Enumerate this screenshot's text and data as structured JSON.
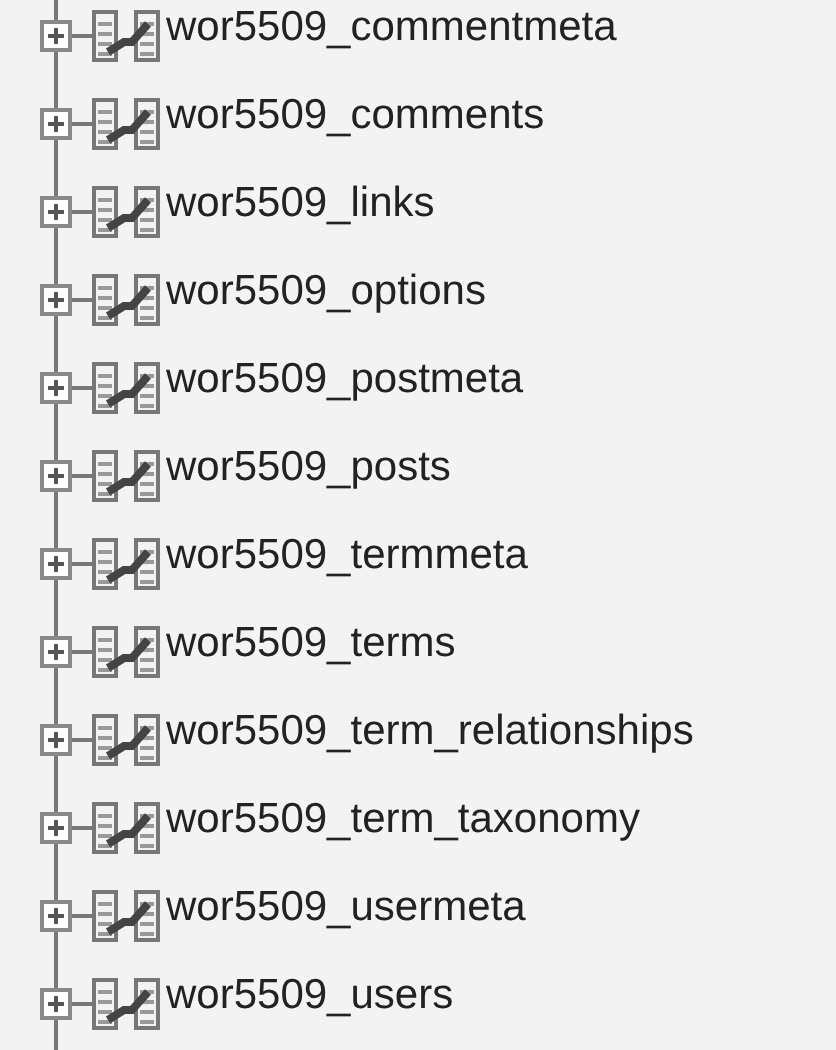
{
  "tables": [
    {
      "name": "wor5509_commentmeta",
      "expanded": false
    },
    {
      "name": "wor5509_comments",
      "expanded": false
    },
    {
      "name": "wor5509_links",
      "expanded": false
    },
    {
      "name": "wor5509_options",
      "expanded": false
    },
    {
      "name": "wor5509_postmeta",
      "expanded": false
    },
    {
      "name": "wor5509_posts",
      "expanded": false
    },
    {
      "name": "wor5509_termmeta",
      "expanded": false
    },
    {
      "name": "wor5509_terms",
      "expanded": false
    },
    {
      "name": "wor5509_term_relationships",
      "expanded": false
    },
    {
      "name": "wor5509_term_taxonomy",
      "expanded": false
    },
    {
      "name": "wor5509_usermeta",
      "expanded": false
    },
    {
      "name": "wor5509_users",
      "expanded": false
    }
  ]
}
